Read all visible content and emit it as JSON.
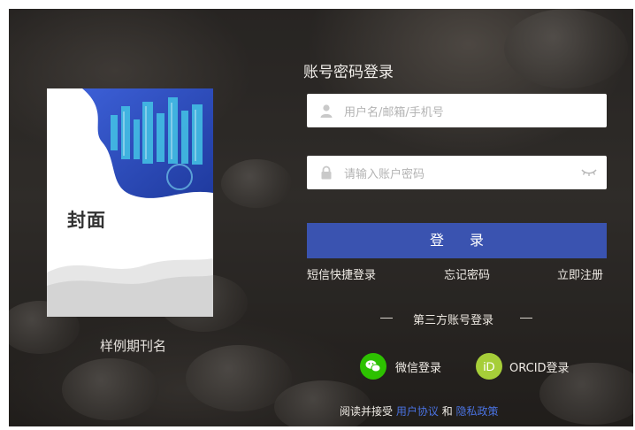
{
  "cover": {
    "title": "封面",
    "journal_name": "样例期刊名"
  },
  "login": {
    "title": "账号密码登录",
    "username_placeholder": "用户名/邮箱/手机号",
    "password_placeholder": "请输入账户密码",
    "submit_label": "登 录",
    "links": {
      "sms_login": "短信快捷登录",
      "forgot_password": "忘记密码",
      "register": "立即注册"
    },
    "third_party_title": "第三方账号登录",
    "wechat_label": "微信登录",
    "orcid_label": "ORCID登录",
    "orcid_icon_text": "iD",
    "agreement": {
      "prefix": "阅读并接受",
      "user_agreement": "用户协议",
      "and": "和",
      "privacy_policy": "隐私政策"
    }
  },
  "icons": {
    "user": "user-icon",
    "lock": "lock-icon",
    "eye": "eye-hidden-icon",
    "wechat": "wechat-icon",
    "orcid": "orcid-icon"
  },
  "colors": {
    "primary": "#3a53b0",
    "wechat": "#2dc100",
    "orcid": "#a6ce39",
    "link_blue": "#4a72e0"
  }
}
